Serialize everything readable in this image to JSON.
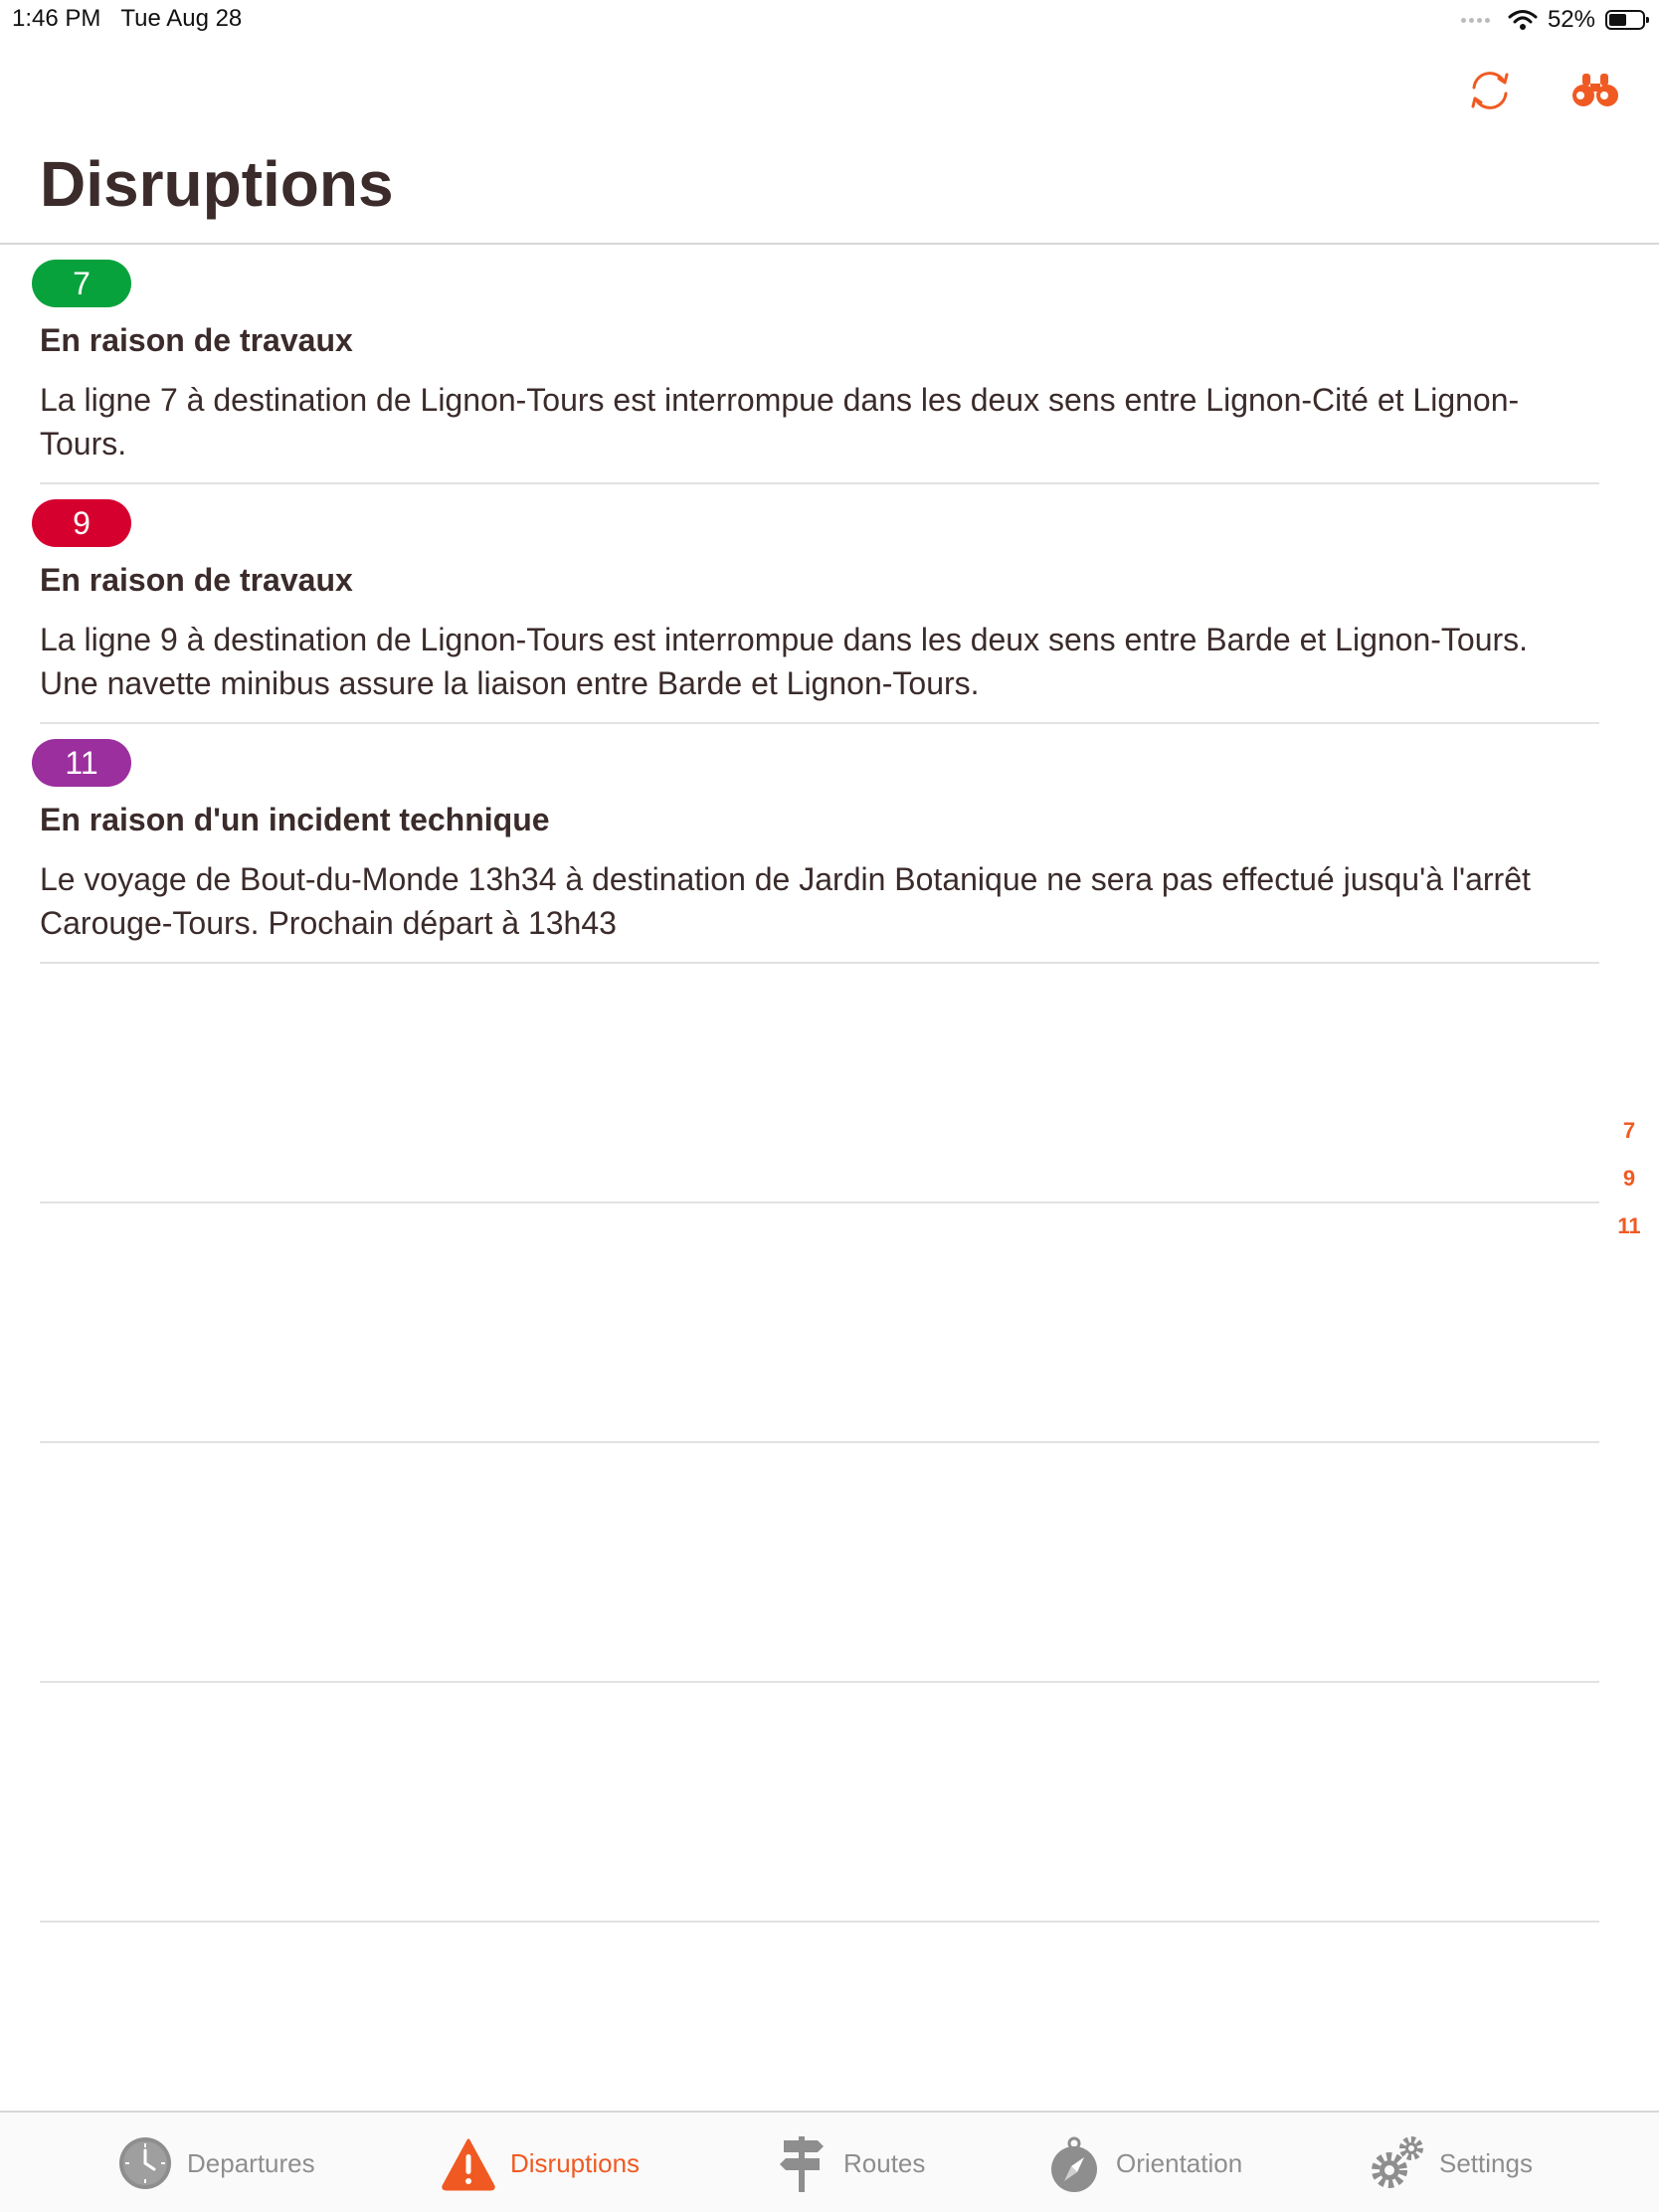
{
  "status_bar": {
    "time": "1:46 PM",
    "date": "Tue Aug 28",
    "battery_percent": "52%",
    "battery_level": 0.52
  },
  "nav": {
    "title": "Disruptions",
    "refresh_icon": "refresh-icon",
    "binoculars_icon": "binoculars-icon"
  },
  "disruptions": [
    {
      "line": "7",
      "color": "#07a23c",
      "title": "En raison de travaux",
      "description": "La ligne 7 à destination de Lignon-Tours est interrompue dans les deux sens entre Lignon-Cité et Lignon-Tours."
    },
    {
      "line": "9",
      "color": "#d6002f",
      "title": "En raison de travaux",
      "description": "La ligne 9 à destination de Lignon-Tours est interrompue dans les deux sens entre Barde et Lignon-Tours. Une navette minibus assure la liaison entre Barde et Lignon-Tours."
    },
    {
      "line": "11",
      "color": "#9b2f9e",
      "title": "En raison d'un incident technique",
      "description": "Le voyage de Bout-du-Monde 13h34 à destination de Jardin Botanique ne sera pas effectué jusqu'à l'arrêt Carouge-Tours. Prochain départ à 13h43"
    }
  ],
  "section_index": [
    "7",
    "9",
    "11"
  ],
  "tab_bar": {
    "accent_color": "#f05a22",
    "inactive_color": "#8e8e8e",
    "tabs": [
      {
        "label": "Departures",
        "icon": "clock-icon",
        "active": false
      },
      {
        "label": "Disruptions",
        "icon": "warning-icon",
        "active": true
      },
      {
        "label": "Routes",
        "icon": "signpost-icon",
        "active": false
      },
      {
        "label": "Orientation",
        "icon": "compass-icon",
        "active": false
      },
      {
        "label": "Settings",
        "icon": "gear-icon",
        "active": false
      }
    ]
  }
}
